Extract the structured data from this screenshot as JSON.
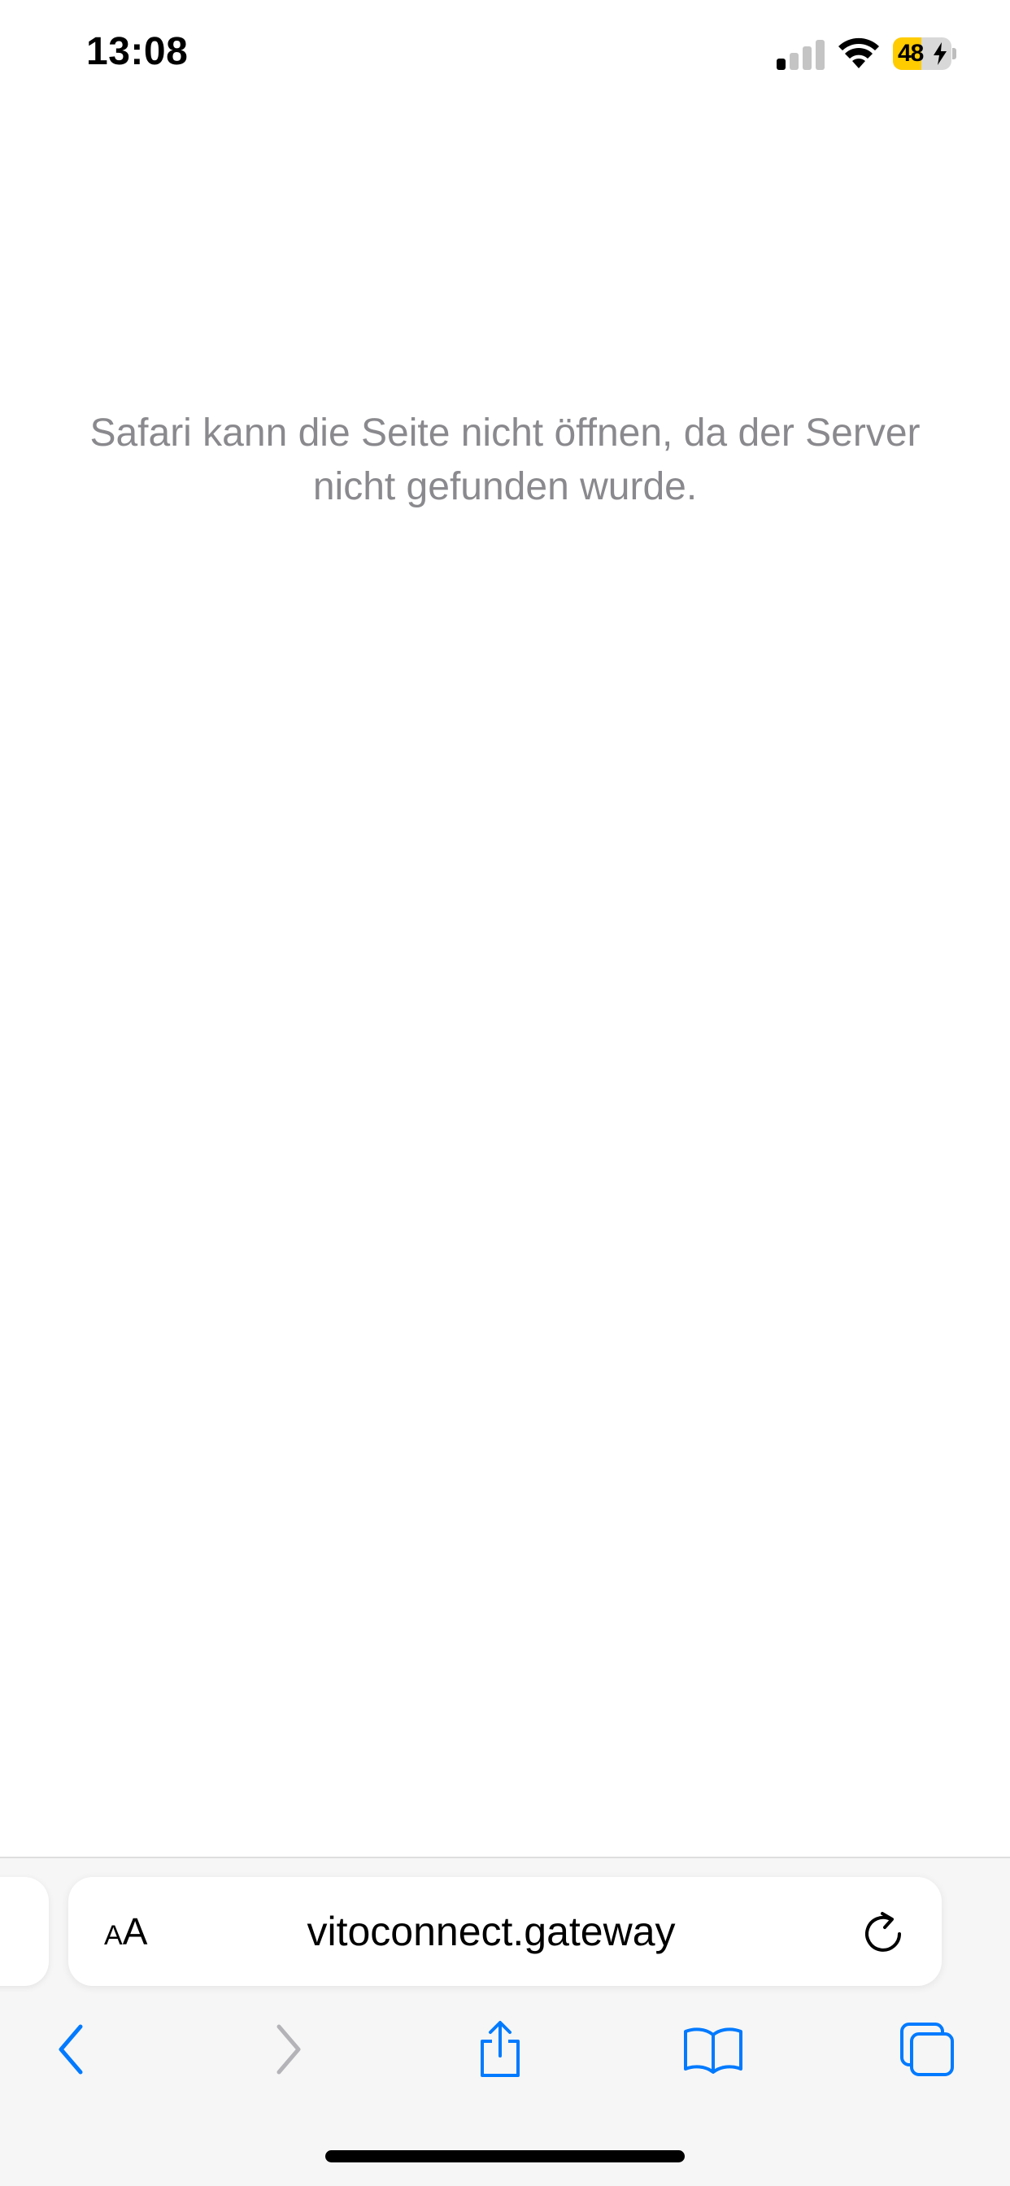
{
  "status_bar": {
    "time": "13:08",
    "battery_level": "48",
    "battery_percent": 48,
    "charging": true,
    "signal_bars_active": 1,
    "signal_bars_total": 4,
    "battery_color": "#ffcc00"
  },
  "page": {
    "error_message": "Safari kann die Seite nicht öffnen, da der Server nicht gefunden wurde."
  },
  "address_bar": {
    "reader_label_small": "A",
    "reader_label_large": "A",
    "url": "vitoconnect.gateway"
  },
  "toolbar": {
    "icons": [
      "back-icon",
      "forward-icon",
      "share-icon",
      "bookmarks-icon",
      "tabs-icon"
    ],
    "accent_color": "#007aff",
    "disabled_color": "#b4b4b8"
  }
}
